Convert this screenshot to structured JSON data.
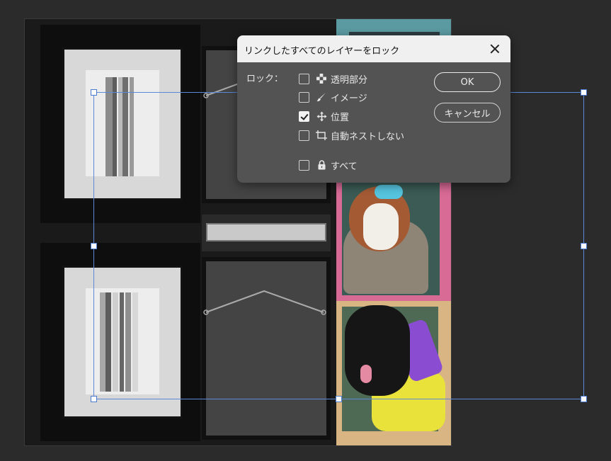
{
  "dialog": {
    "title": "リンクしたすべてのレイヤーをロック",
    "lock_label": "ロック：",
    "options": [
      {
        "label": "透明部分",
        "checked": false,
        "icon": "checkerboard-icon"
      },
      {
        "label": "イメージ",
        "checked": false,
        "icon": "brush-icon"
      },
      {
        "label": "位置",
        "checked": true,
        "icon": "move-arrows-icon"
      },
      {
        "label": "自動ネストしない",
        "checked": false,
        "icon": "artboard-nest-icon"
      },
      {
        "label": "すべて",
        "checked": false,
        "icon": "padlock-icon"
      }
    ],
    "ok_label": "OK",
    "cancel_label": "キャンセル"
  },
  "colors": {
    "background": "#2b2b2b",
    "dialog_body": "#535353",
    "dialog_titlebar": "#f0f0f0",
    "selection_line": "#5c88d8",
    "pink_tile": "#d86a96",
    "tan_tile": "#d9b584",
    "teal_tile": "#5a9aa0"
  }
}
